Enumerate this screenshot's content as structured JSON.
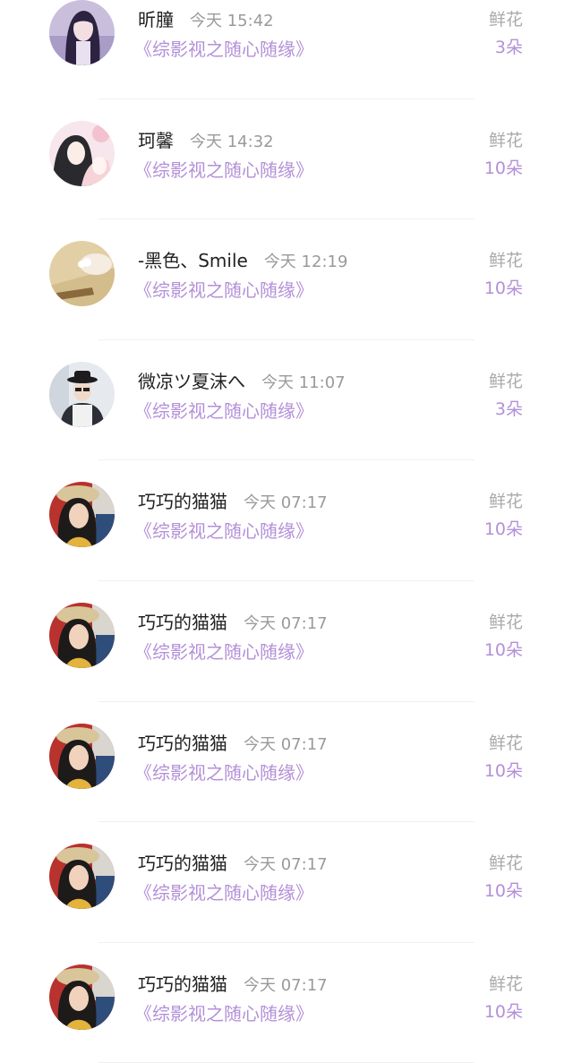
{
  "colors": {
    "accent": "#b390d8",
    "name": "#222222",
    "time": "#9a9a9a",
    "label": "#aaaaaa",
    "divider": "#f0f0f0"
  },
  "rows": [
    {
      "avatar_icon": "anime-girl-avatar",
      "name": "昕朣",
      "time": "今天 15:42",
      "book": "《综影视之随心随缘》",
      "gift_label": "鲜花",
      "gift_count": "3朵"
    },
    {
      "avatar_icon": "anime-couple-avatar",
      "name": "珂馨",
      "time": "今天 14:32",
      "book": "《综影视之随心随缘》",
      "gift_label": "鲜花",
      "gift_count": "10朵"
    },
    {
      "avatar_icon": "sand-hand-avatar",
      "name": "-黑色、Smile",
      "time": "今天 12:19",
      "book": "《综影视之随心随缘》",
      "gift_label": "鲜花",
      "gift_count": "10朵"
    },
    {
      "avatar_icon": "person-hat-avatar",
      "name": "微凉ツ夏沫へ",
      "time": "今天 11:07",
      "book": "《综影视之随心随缘》",
      "gift_label": "鲜花",
      "gift_count": "3朵"
    },
    {
      "avatar_icon": "woman-hat-avatar",
      "name": "巧巧的猫猫",
      "time": "今天 07:17",
      "book": "《综影视之随心随缘》",
      "gift_label": "鲜花",
      "gift_count": "10朵"
    },
    {
      "avatar_icon": "woman-hat-avatar",
      "name": "巧巧的猫猫",
      "time": "今天 07:17",
      "book": "《综影视之随心随缘》",
      "gift_label": "鲜花",
      "gift_count": "10朵"
    },
    {
      "avatar_icon": "woman-hat-avatar",
      "name": "巧巧的猫猫",
      "time": "今天 07:17",
      "book": "《综影视之随心随缘》",
      "gift_label": "鲜花",
      "gift_count": "10朵"
    },
    {
      "avatar_icon": "woman-hat-avatar",
      "name": "巧巧的猫猫",
      "time": "今天 07:17",
      "book": "《综影视之随心随缘》",
      "gift_label": "鲜花",
      "gift_count": "10朵"
    },
    {
      "avatar_icon": "woman-hat-avatar",
      "name": "巧巧的猫猫",
      "time": "今天 07:17",
      "book": "《综影视之随心随缘》",
      "gift_label": "鲜花",
      "gift_count": "10朵"
    }
  ]
}
